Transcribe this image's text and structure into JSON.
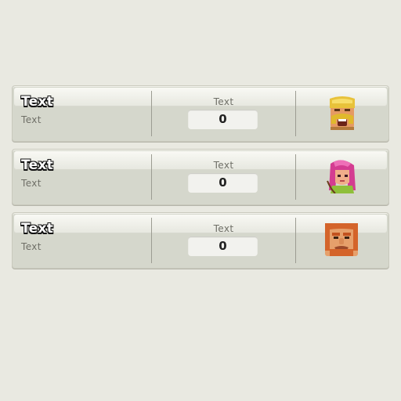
{
  "rows": [
    {
      "title": "Text",
      "subtitle": "Text",
      "label": "Text",
      "value": "0",
      "icon": "barbarian-portrait-icon"
    },
    {
      "title": "Text",
      "subtitle": "Text",
      "label": "Text",
      "value": "0",
      "icon": "archer-portrait-icon"
    },
    {
      "title": "Text",
      "subtitle": "Text",
      "label": "Text",
      "value": "0",
      "icon": "giant-portrait-icon"
    }
  ],
  "colors": {
    "background": "#e9e9e1",
    "row": "#d5d7cc",
    "row_gloss": "#f9f9f4",
    "value_box": "#f2f2ee",
    "label_text": "#6f6f67"
  }
}
